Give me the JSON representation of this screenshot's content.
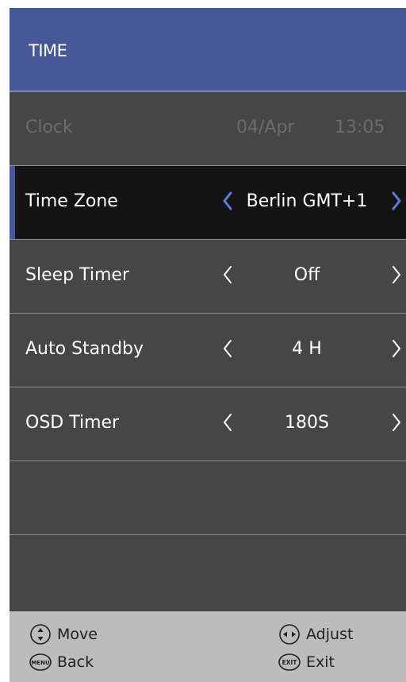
{
  "header": {
    "title": "TIME"
  },
  "clock": {
    "label": "Clock",
    "date": "04/Apr",
    "time": "13:05"
  },
  "rows": [
    {
      "label": "Time Zone",
      "value": "Berlin GMT+1"
    },
    {
      "label": "Sleep Timer",
      "value": "Off"
    },
    {
      "label": "Auto Standby",
      "value": "4 H"
    },
    {
      "label": "OSD Timer",
      "value": "180S"
    }
  ],
  "footer": {
    "move_label": "Move",
    "back_label": "Back",
    "adjust_label": "Adjust",
    "exit_label": "Exit",
    "menu_key": "MENU",
    "exit_key": "EXIT"
  },
  "colors": {
    "header_bg": "#475899",
    "panel_bg": "#464646",
    "selected_row_bg": "#141414",
    "accent": "#475899",
    "footer_bg": "#bcbcbc",
    "disabled_text": "#6c6c6c"
  },
  "icons": {
    "prev": "chevron-left-icon",
    "next": "chevron-right-icon",
    "move": "up-down-icon",
    "adjust": "left-right-icon",
    "menu_key": "menu-key-icon",
    "exit_key": "exit-key-icon"
  }
}
